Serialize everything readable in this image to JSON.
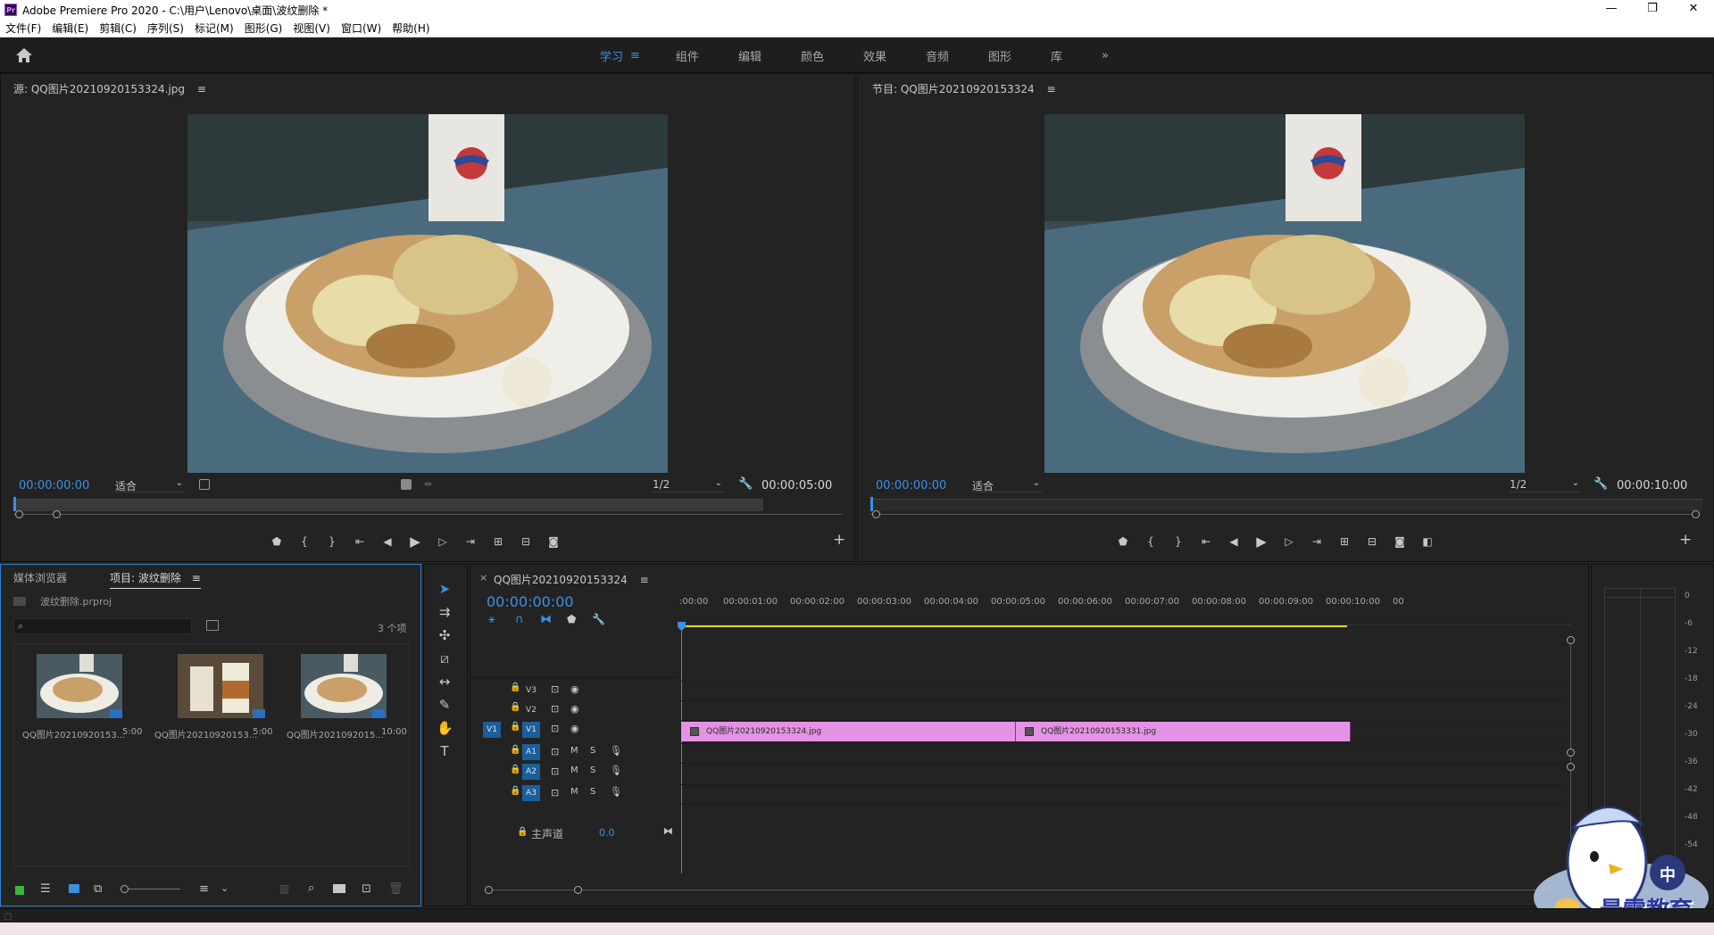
{
  "window": {
    "app_icon_text": "Pr",
    "title": "Adobe Premiere Pro 2020 - C:\\用户\\Lenovo\\桌面\\波纹删除 *",
    "controls": {
      "minimize": "—",
      "maximize": "❐",
      "close": "✕"
    }
  },
  "menu": [
    "文件(F)",
    "编辑(E)",
    "剪辑(C)",
    "序列(S)",
    "标记(M)",
    "图形(G)",
    "视图(V)",
    "窗口(W)",
    "帮助(H)"
  ],
  "workspaces": {
    "tabs": [
      "学习",
      "组件",
      "编辑",
      "颜色",
      "效果",
      "音频",
      "图形",
      "库"
    ],
    "active": "学习",
    "menu_icon": "≡",
    "more": "»"
  },
  "source_monitor": {
    "title": "源: QQ图片20210920153324.jpg",
    "menu_icon": "≡",
    "timecode": "00:00:00:00",
    "fit": "适合",
    "resolution": "1/2",
    "duration": "00:00:05:00"
  },
  "program_monitor": {
    "title": "节目: QQ图片20210920153324",
    "menu_icon": "≡",
    "timecode": "00:00:00:00",
    "fit": "适合",
    "resolution": "1/2",
    "duration": "00:00:10:00"
  },
  "project": {
    "tab_media": "媒体浏览器",
    "tab_project": "项目: 波纹删除",
    "menu_icon": "≡",
    "file": "波纹删除.prproj",
    "count": "3 个项",
    "search_placeholder": "",
    "items": [
      {
        "name": "QQ图片20210920153...",
        "duration": "5:00"
      },
      {
        "name": "QQ图片20210920153...",
        "duration": "5:00"
      },
      {
        "name": "QQ图片2021092015...",
        "duration": "10:00"
      }
    ]
  },
  "timeline": {
    "tab_title": "QQ图片20210920153324",
    "close": "×",
    "menu_icon": "≡",
    "timecode": "00:00:00:00",
    "ruler": [
      ":00:00",
      "00:00:01:00",
      "00:00:02:00",
      "00:00:03:00",
      "00:00:04:00",
      "00:00:05:00",
      "00:00:06:00",
      "00:00:07:00",
      "00:00:08:00",
      "00:00:09:00",
      "00:00:10:00",
      "00"
    ],
    "video_tracks": [
      "V3",
      "V2",
      "V1"
    ],
    "audio_tracks": [
      "A1",
      "A2",
      "A3"
    ],
    "source_patch_video": "V1",
    "mute": "M",
    "solo": "S",
    "master": "主声道",
    "master_value": "0.0",
    "clips": [
      {
        "name": "QQ图片20210920153324.jpg",
        "start": 0,
        "end": 5
      },
      {
        "name": "QQ图片20210920153331.jpg",
        "start": 5,
        "end": 10
      }
    ]
  },
  "audio_meter": {
    "ticks": [
      "0",
      "-6",
      "-12",
      "-18",
      "-24",
      "-30",
      "-36",
      "-42",
      "-48",
      "-54"
    ]
  },
  "watermark": {
    "text": "最需教育",
    "ime": "中"
  }
}
